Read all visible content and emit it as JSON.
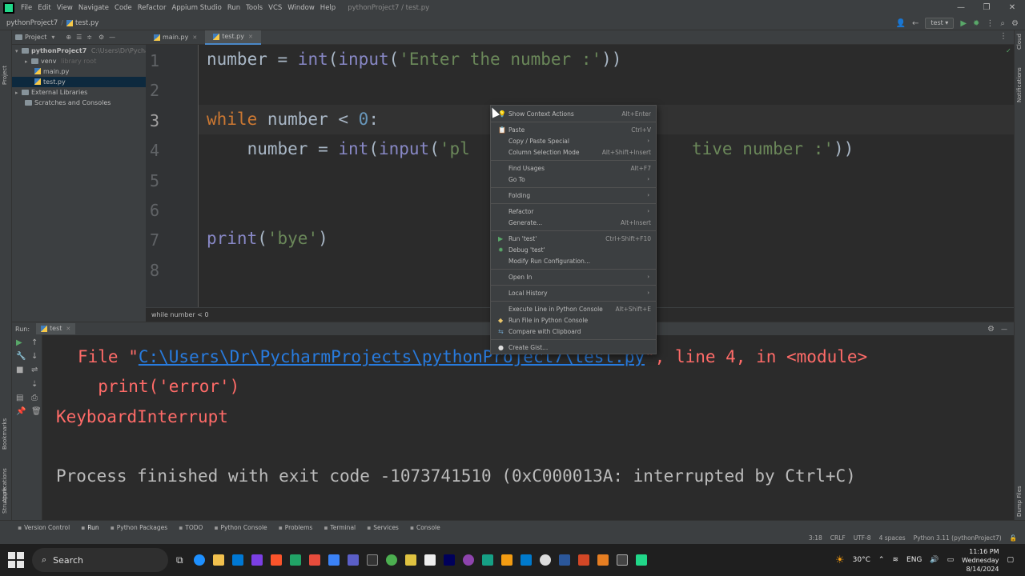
{
  "menubar": {
    "items": [
      "File",
      "Edit",
      "View",
      "Navigate",
      "Code",
      "Refactor",
      "Appium Studio",
      "Run",
      "Tools",
      "VCS",
      "Window",
      "Help"
    ],
    "title": "pythonProject7 / test.py"
  },
  "navbar": {
    "project": "pythonProject7",
    "file": "test.py",
    "run_config": "test"
  },
  "project_panel": {
    "header": "Project",
    "items": [
      {
        "label": "pythonProject7",
        "extra": "C:\\Users\\Dr\\Pycharm"
      },
      {
        "label": "venv",
        "extra": "library root"
      },
      {
        "label": "main.py"
      },
      {
        "label": "test.py"
      },
      {
        "label": "External Libraries"
      },
      {
        "label": "Scratches and Consoles"
      }
    ]
  },
  "left_stripe": {
    "project": "Project",
    "bookmarks": "Bookmarks",
    "applications": "Applications",
    "structure": "Structure"
  },
  "right_stripe": {
    "cloud": "Cloud",
    "notifications": "Notifications",
    "dump": "Dump Files"
  },
  "tabs": [
    {
      "label": "main.py"
    },
    {
      "label": "test.py"
    }
  ],
  "editor": {
    "line_numbers": [
      "1",
      "2",
      "3",
      "4",
      "5",
      "6",
      "7",
      "8"
    ],
    "line1": {
      "a": "number = ",
      "b": "int",
      "c": "(",
      "d": "input",
      "e": "(",
      "f": "'Enter the number :'",
      "g": "))"
    },
    "line3": {
      "a": "while",
      "b": " number < ",
      "c": "0",
      "d": ":"
    },
    "line4": {
      "a": "    number = ",
      "b": "int",
      "c": "(",
      "d": "input",
      "e": "(",
      "f": "'pl",
      "g": "tive number :'",
      "h": "))"
    },
    "line7": {
      "a": "print",
      "b": "(",
      "c": "'bye'",
      "d": ")"
    },
    "breadcrumb": "while number < 0"
  },
  "run_panel": {
    "label": "Run:",
    "tab": "test",
    "lines": {
      "l1a": "File \"",
      "l1link": "C:\\Users\\Dr\\PycharmProjects\\pythonProject7\\test.py",
      "l1b": "\", line 4, in <module>",
      "l2": "  print('error')",
      "l3": "KeyboardInterrupt",
      "l4": "Process finished with exit code -1073741510 (0xC000013A: interrupted by Ctrl+C)"
    }
  },
  "context_menu": {
    "items": [
      {
        "label": "Show Context Actions",
        "shortcut": "Alt+Enter"
      },
      {
        "label": "Paste",
        "shortcut": "Ctrl+V"
      },
      {
        "label": "Copy / Paste Special",
        "shortcut": ""
      },
      {
        "label": "Column Selection Mode",
        "shortcut": "Alt+Shift+Insert"
      },
      {
        "label": "Find Usages",
        "shortcut": "Alt+F7"
      },
      {
        "label": "Go To",
        "shortcut": ""
      },
      {
        "label": "Folding",
        "shortcut": ""
      },
      {
        "label": "Refactor",
        "shortcut": ""
      },
      {
        "label": "Generate...",
        "shortcut": "Alt+Insert"
      },
      {
        "label": "Run 'test'",
        "shortcut": "Ctrl+Shift+F10"
      },
      {
        "label": "Debug 'test'",
        "shortcut": ""
      },
      {
        "label": "Modify Run Configuration...",
        "shortcut": ""
      },
      {
        "label": "Open In",
        "shortcut": ""
      },
      {
        "label": "Local History",
        "shortcut": ""
      },
      {
        "label": "Execute Line in Python Console",
        "shortcut": "Alt+Shift+E"
      },
      {
        "label": "Run File in Python Console",
        "shortcut": ""
      },
      {
        "label": "Compare with Clipboard",
        "shortcut": ""
      },
      {
        "label": "Create Gist...",
        "shortcut": ""
      }
    ]
  },
  "bottom_tabs": [
    "Version Control",
    "Run",
    "Python Packages",
    "TODO",
    "Python Console",
    "Problems",
    "Terminal",
    "Services",
    "Console"
  ],
  "status": {
    "position": "3:18",
    "line_sep": "CRLF",
    "encoding": "UTF-8",
    "indent": "4 spaces",
    "interpreter": "Python 3.11 (pythonProject7)"
  },
  "taskbar": {
    "search": "Search",
    "weather": "30°C",
    "lang": "ENG",
    "time": "11:16 PM",
    "day": "Wednesday",
    "date": "8/14/2024"
  },
  "colors": {
    "keyword": "#cc7832",
    "string": "#6a8759",
    "number": "#6897bb",
    "builtin": "#8888c6",
    "error": "#ff6b68",
    "link": "#287bde"
  }
}
